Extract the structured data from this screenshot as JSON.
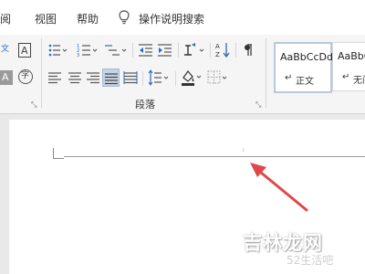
{
  "menu": {
    "items": [
      "阅",
      "视图",
      "帮助"
    ],
    "tell_me": "操作说明搜索"
  },
  "ribbon": {
    "font_buttons": {
      "phonetic": "文",
      "border_char": "A",
      "shade_char": "A",
      "enclose_char": "字"
    },
    "paragraph_label": "段落",
    "styles": [
      {
        "sample": "AaBbCcDd",
        "name": "正文"
      },
      {
        "sample": "AaBbCc",
        "name": "无间"
      }
    ]
  },
  "watermark": {
    "main": "吉林龙网",
    "sub": "52生活吧"
  },
  "colors": {
    "arrow": "#e0474a",
    "active_btn": "#c5d3e4",
    "accent_border": "#b8c8dd"
  }
}
